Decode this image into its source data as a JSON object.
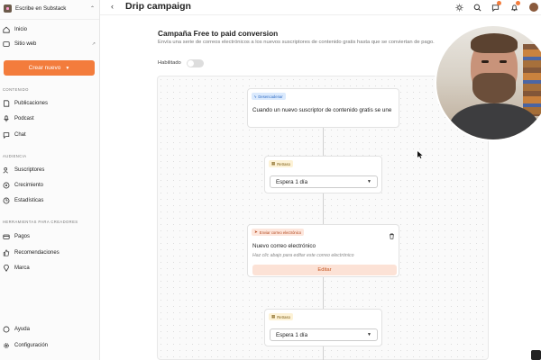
{
  "sidebar": {
    "workspace": "Escribe en Substack",
    "nav_top": [
      {
        "label": "Inicio"
      },
      {
        "label": "Sitio web"
      }
    ],
    "create_button": "Crear nuevo",
    "sections": {
      "contenido": "CONTENIDO",
      "audiencia": "AUDIENCIA",
      "herramientas": "HERRAMIENTAS PARA CREADORES"
    },
    "contenido_items": [
      "Publicaciones",
      "Podcast",
      "Chat"
    ],
    "audiencia_items": [
      "Suscriptores",
      "Crecimiento",
      "Estadísticas"
    ],
    "herramientas_items": [
      "Pagos",
      "Recomendaciones",
      "Marca"
    ],
    "footer_items": [
      "Ayuda",
      "Configuración"
    ]
  },
  "header": {
    "title": "Drip campaign"
  },
  "campaign": {
    "title": "Campaña Free to paid conversion",
    "description": "Envía una serie de correos electrónicos a los nuevos suscriptores de contenido gratis hasta que se conviertan de pago.",
    "enabled_label": "Habilitado",
    "enabled": false
  },
  "flow": {
    "trigger": {
      "badge": "Desencadenar",
      "text": "Cuando un nuevo suscriptor de contenido gratis se une"
    },
    "delay1": {
      "badge": "Retraso",
      "value": "Espera 1 día"
    },
    "email": {
      "badge": "Enviar correo electrónico",
      "title": "Nuevo correo electrónico",
      "hint": "Haz clic abajo para editar este correo electrónico",
      "edit_label": "Editar"
    },
    "delay2": {
      "badge": "Retraso",
      "value": "Espera 1 día"
    }
  },
  "colors": {
    "accent": "#f37c3c",
    "trigger_badge": "#dbeafd",
    "delay_badge": "#fdf2d6",
    "email_badge": "#fde6dc"
  },
  "icons": {
    "theme": "sun-icon",
    "search": "search-icon",
    "messages": "chat-bubble-icon",
    "notifications": "bell-icon"
  }
}
